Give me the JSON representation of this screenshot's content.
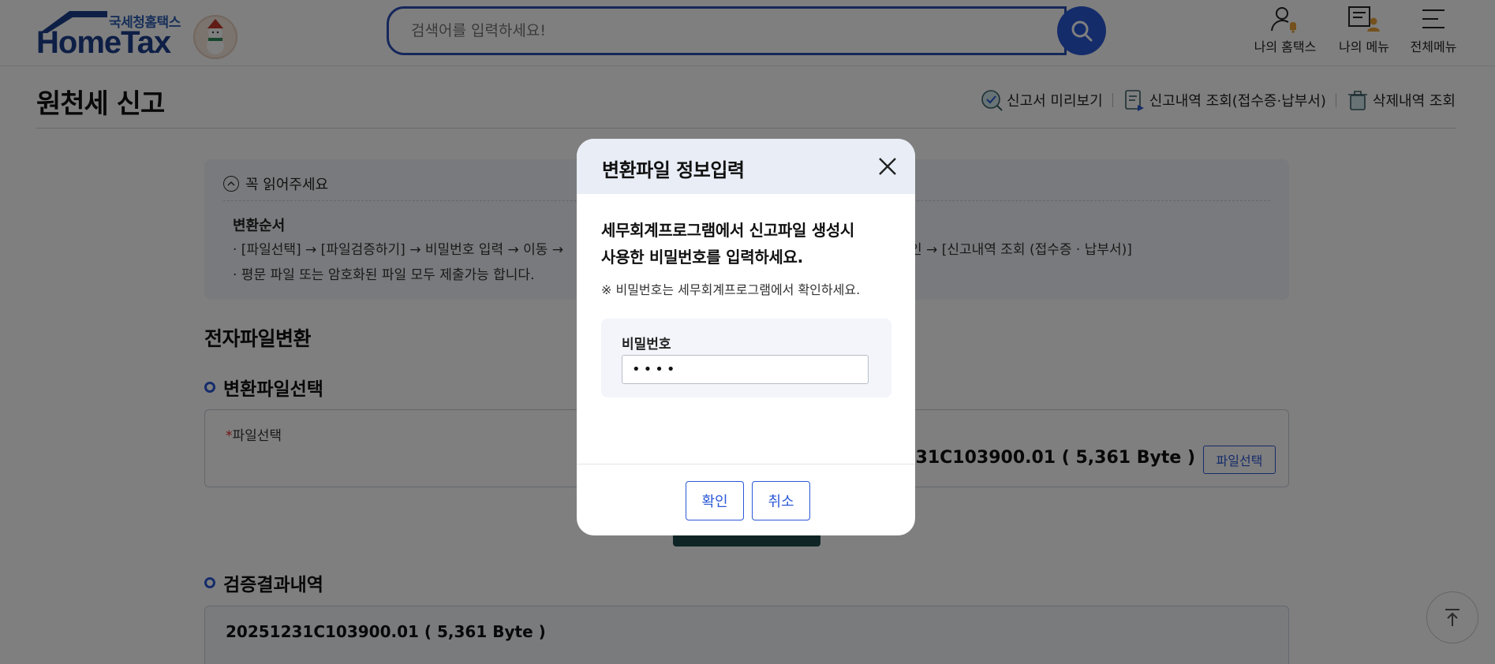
{
  "header": {
    "logo_sub": "국세청홈택스",
    "logo_main": "HomeTax",
    "search_placeholder": "검색어를 입력하세요!",
    "menus": [
      {
        "label": "나의 홈택스",
        "icon": "user-bell-icon"
      },
      {
        "label": "나의 메뉴",
        "icon": "menu-user-icon"
      },
      {
        "label": "전체메뉴",
        "icon": "hamburger-icon"
      }
    ]
  },
  "page": {
    "title": "원천세 신고",
    "quick_links": [
      {
        "label": "신고서 미리보기",
        "icon": "preview-check-icon"
      },
      {
        "label": "신고내역 조회(접수증·납부서)",
        "icon": "document-list-icon"
      },
      {
        "label": "삭제내역 조회",
        "icon": "trash-icon"
      }
    ]
  },
  "notice": {
    "heading": "꼭 읽어주세요",
    "subheading": "변환순서",
    "line1_left": "· [파일선택] → [파일검증하기] → 비밀번호 입력 → 이동 →",
    "line1_right": "인 → [신고내역 조회 (접수증 · 납부서)]",
    "line2": "· 평문 파일 또는 암호화된 파일 모두 제출가능 합니다."
  },
  "section": {
    "title": "전자파일변환",
    "file_select_title": "변환파일선택",
    "file_label_req": "*",
    "file_label": "파일선택",
    "file_name": "20251231C103900.01 ( 5,361 Byte )",
    "file_name_visible": "0251231C103900.01 ( 5,361 Byte )",
    "file_button": "파일선택",
    "result_title": "검증결과내역",
    "result_text": "20251231C103900.01 ( 5,361 Byte )"
  },
  "modal": {
    "title": "변환파일 정보입력",
    "message_line1": "세무회계프로그램에서 신고파일 생성시",
    "message_line2": "사용한 비밀번호를 입력하세요.",
    "note": "※ 비밀번호는 세무회계프로그램에서 확인하세요.",
    "password_label": "비밀번호",
    "password_value": "••••",
    "confirm": "확인",
    "cancel": "취소"
  },
  "colors": {
    "brand_blue": "#2b58d6",
    "logo_navy": "#1d3f8c",
    "required_red": "#e02a2a"
  }
}
